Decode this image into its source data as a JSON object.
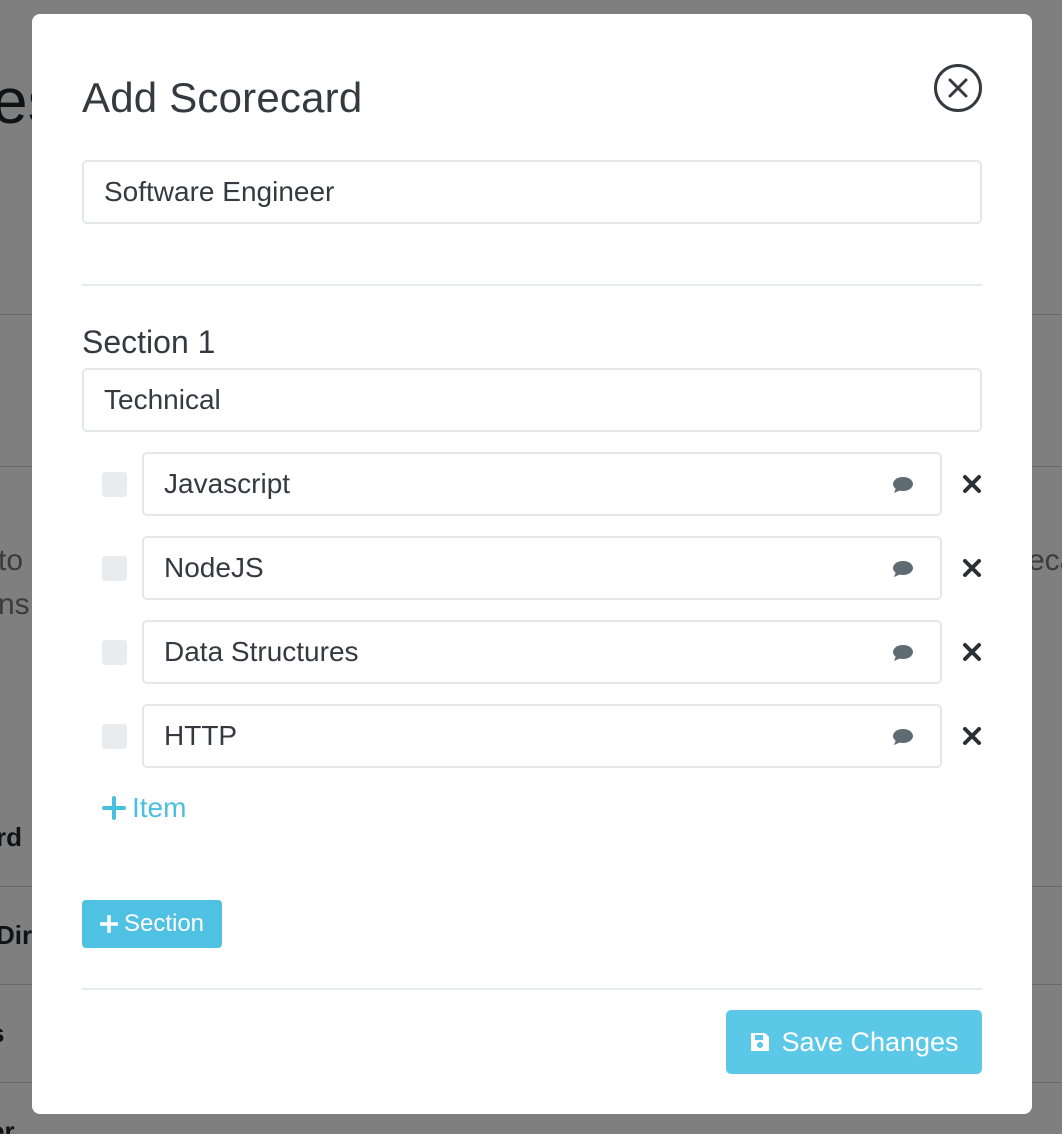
{
  "background": {
    "heading_fragment": "es",
    "text_left_1": "to",
    "text_left_2": "ns i",
    "text_right_1": "eca",
    "row_labels": [
      "rd",
      "Dir",
      "s",
      "er"
    ]
  },
  "modal": {
    "title": "Add Scorecard",
    "scorecard_name": "Software Engineer",
    "sections": [
      {
        "heading": "Section 1",
        "name": "Technical",
        "items": [
          {
            "label": "Javascript"
          },
          {
            "label": "NodeJS"
          },
          {
            "label": "Data Structures"
          },
          {
            "label": "HTTP"
          }
        ]
      }
    ],
    "add_item_label": "Item",
    "add_section_label": "Section",
    "save_label": "Save Changes"
  },
  "colors": {
    "accent": "#4fc1e3",
    "save_button": "#5bc8e8",
    "text": "#343a40",
    "input_border": "#e4e6e8",
    "overlay": "rgba(0,0,0,0.5)"
  },
  "icons": {
    "close": "close-circle-icon",
    "comment": "comment-icon",
    "remove": "times-icon",
    "add": "plus-icon",
    "save": "floppy-disk-icon"
  }
}
